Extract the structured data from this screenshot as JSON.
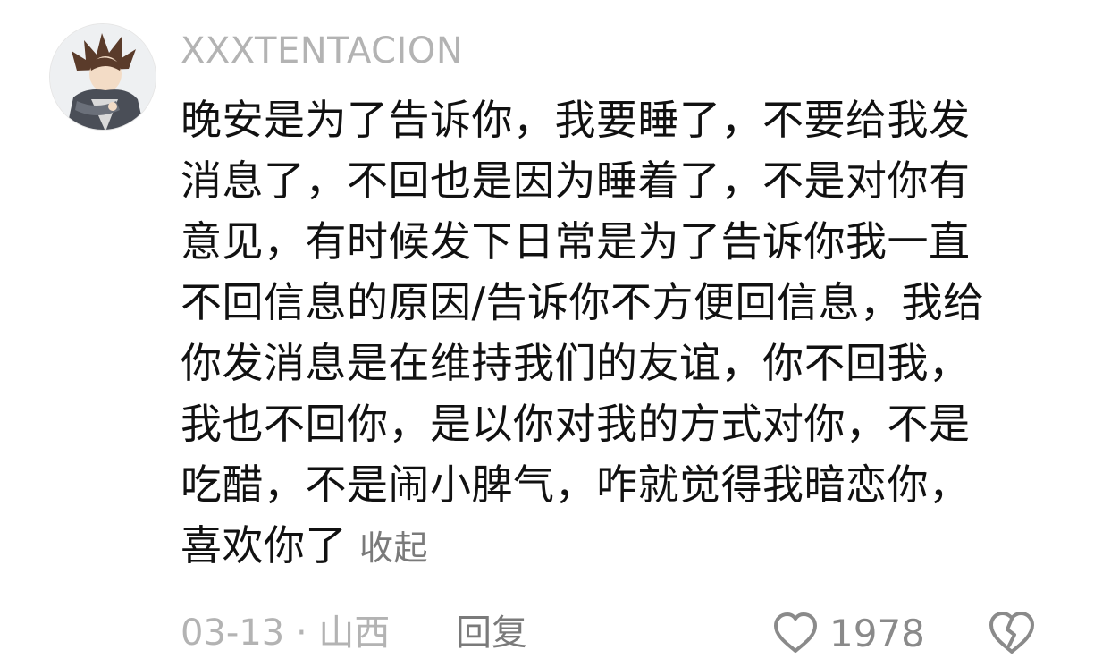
{
  "comment": {
    "username": "XXXTENTACION",
    "lines": [
      "晚安是为了告诉你，我要睡了，不要给我发",
      "消息了，不回也是因为睡着了，不是对你有",
      "意见，有时候发下日常是为了告诉你我一直",
      "不回信息的原因/告诉你不方便回信息，我给",
      "你发消息是在维持我们的友谊，你不回我，",
      "我也不回你，是以你对我的方式对你，不是",
      "吃醋，不是闹小脾气，咋就觉得我暗恋你，",
      "喜欢你了"
    ],
    "collapse_label": "收起",
    "meta": "03-13 · 山西",
    "reply_label": "回复",
    "like_count": "1978",
    "icons": {
      "like": "heart-outline-icon",
      "dislike": "broken-heart-icon"
    },
    "colors": {
      "text": "#111111",
      "muted": "#b3b3b3",
      "secondary": "#7a7a7a"
    }
  }
}
